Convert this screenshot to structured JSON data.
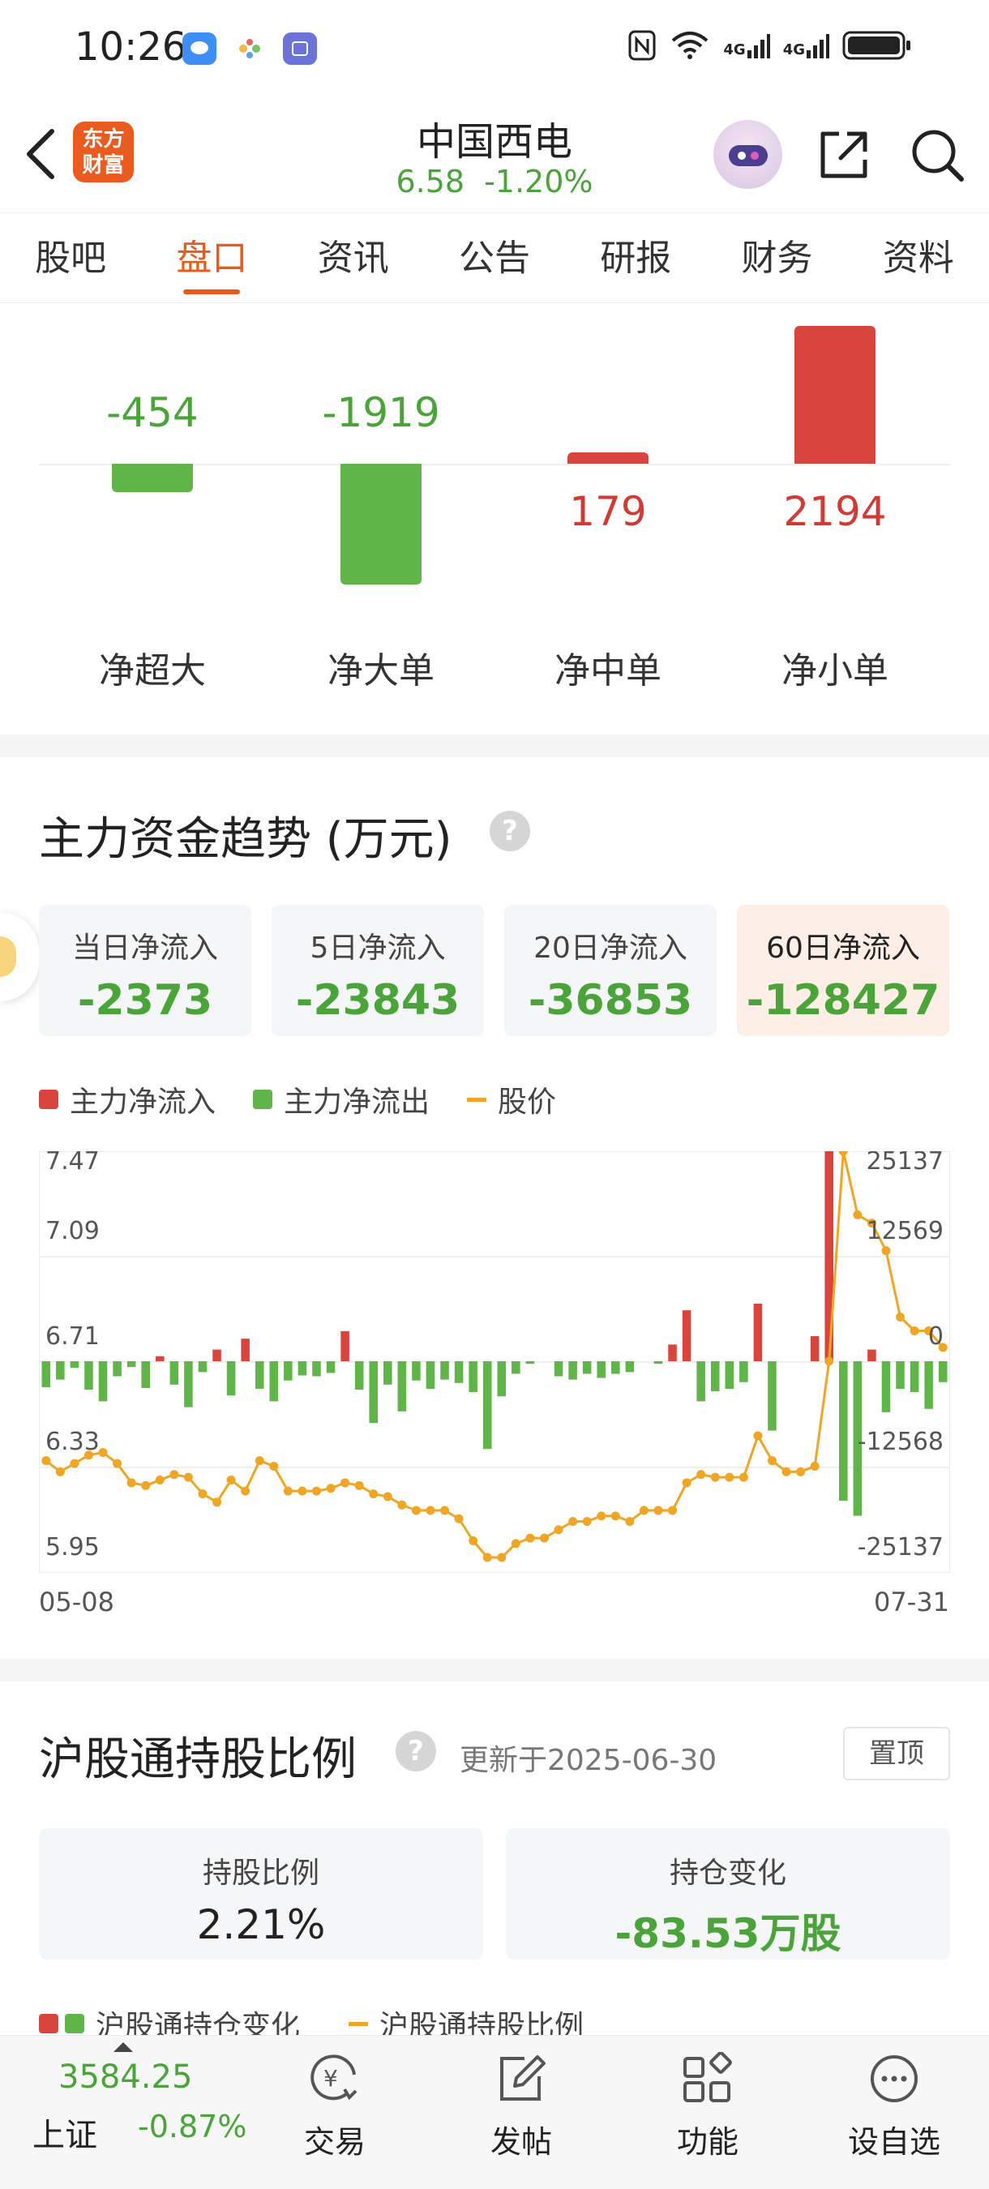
{
  "status_bar": {
    "time": "10:26",
    "network_labels": [
      "4G",
      "4G"
    ]
  },
  "header": {
    "logo_line1": "东方",
    "logo_line2": "财富",
    "stock_name": "中国西电",
    "price": "6.58",
    "change_pct": "-1.20%"
  },
  "tabs": [
    {
      "label": "股吧"
    },
    {
      "label": "盘口"
    },
    {
      "label": "资讯"
    },
    {
      "label": "公告"
    },
    {
      "label": "研报"
    },
    {
      "label": "财务"
    },
    {
      "label": "资料"
    }
  ],
  "active_tab": "盘口",
  "net_flow": {
    "items": [
      {
        "label": "净超大",
        "value": -454
      },
      {
        "label": "净大单",
        "value": -1919
      },
      {
        "label": "净中单",
        "value": 179
      },
      {
        "label": "净小单",
        "value": 2194
      }
    ]
  },
  "trend": {
    "title": "主力资金趋势 (万元)",
    "help": "?",
    "cards": [
      {
        "label": "当日净流入",
        "value": "-2373"
      },
      {
        "label": "5日净流入",
        "value": "-23843"
      },
      {
        "label": "20日净流入",
        "value": "-36853"
      },
      {
        "label": "60日净流入",
        "value": "-128427"
      }
    ],
    "legend": [
      {
        "label": "主力净流入",
        "color": "#d9453d"
      },
      {
        "label": "主力净流出",
        "color": "#5fb548"
      },
      {
        "label": "股价",
        "color": "#f0a524"
      }
    ]
  },
  "chart_data": {
    "type": "bar",
    "x_start": "05-08",
    "x_end": "07-31",
    "price_axis_ticks": [
      "7.47",
      "7.09",
      "6.71",
      "6.33",
      "5.95"
    ],
    "flow_axis_ticks": [
      "25137",
      "12569",
      "0",
      "-12568",
      "-25137"
    ],
    "price_range": [
      5.95,
      7.47
    ],
    "flow_range": [
      -25137,
      25137
    ],
    "series": [
      {
        "name": "主力净流入/主力净流出",
        "values": [
          -3100,
          -2200,
          -800,
          -3400,
          -4800,
          -1800,
          -700,
          -3200,
          600,
          -2800,
          -5500,
          -1300,
          1400,
          -4100,
          2700,
          -3300,
          -4800,
          -2300,
          -1700,
          -1800,
          -1400,
          3600,
          -3400,
          -7400,
          -2800,
          -6000,
          -2300,
          -3300,
          -2200,
          -2600,
          -3700,
          -10500,
          -4200,
          -1500,
          -300,
          0,
          -1800,
          -2200,
          -1500,
          -2000,
          -1500,
          -1300,
          0,
          -300,
          2000,
          6100,
          -4800,
          -3600,
          -3300,
          -2500,
          6900,
          -8300,
          0,
          0,
          3000,
          25137,
          -16700,
          -18500,
          1400,
          -6100,
          -3300,
          -3700,
          -5700,
          -2500
        ]
      },
      {
        "name": "股价",
        "values": [
          6.35,
          6.31,
          6.34,
          6.37,
          6.38,
          6.34,
          6.27,
          6.26,
          6.28,
          6.3,
          6.29,
          6.23,
          6.2,
          6.28,
          6.24,
          6.35,
          6.33,
          6.24,
          6.24,
          6.24,
          6.25,
          6.27,
          6.26,
          6.23,
          6.22,
          6.19,
          6.17,
          6.17,
          6.17,
          6.14,
          6.06,
          6.0,
          6.0,
          6.05,
          6.07,
          6.07,
          6.1,
          6.13,
          6.13,
          6.15,
          6.15,
          6.13,
          6.17,
          6.17,
          6.17,
          6.27,
          6.3,
          6.29,
          6.29,
          6.29,
          6.44,
          6.35,
          6.31,
          6.31,
          6.33,
          6.71,
          7.47,
          7.24,
          7.21,
          7.11,
          6.87,
          6.82,
          6.82,
          6.76
        ]
      }
    ]
  },
  "hk_connect": {
    "title": "沪股通持股比例",
    "help": "?",
    "updated": "更新于2025-06-30",
    "pin_label": "置顶",
    "cards": [
      {
        "label": "持股比例",
        "value": "2.21%"
      },
      {
        "label": "持仓变化",
        "value": "-83.53万股"
      }
    ],
    "legend": [
      {
        "label": "沪股通持仓变化"
      },
      {
        "label": "沪股通持股比例"
      }
    ]
  },
  "bottom_bar": {
    "index_value": "3584.25",
    "index_name": "上证",
    "index_change": "-0.87%",
    "nav": [
      {
        "label": "交易"
      },
      {
        "label": "发帖"
      },
      {
        "label": "功能"
      },
      {
        "label": "设自选"
      }
    ]
  },
  "colors": {
    "up": "#d9453d",
    "down": "#5fb548",
    "price_line": "#f0a524",
    "accent": "#e85b1b"
  }
}
